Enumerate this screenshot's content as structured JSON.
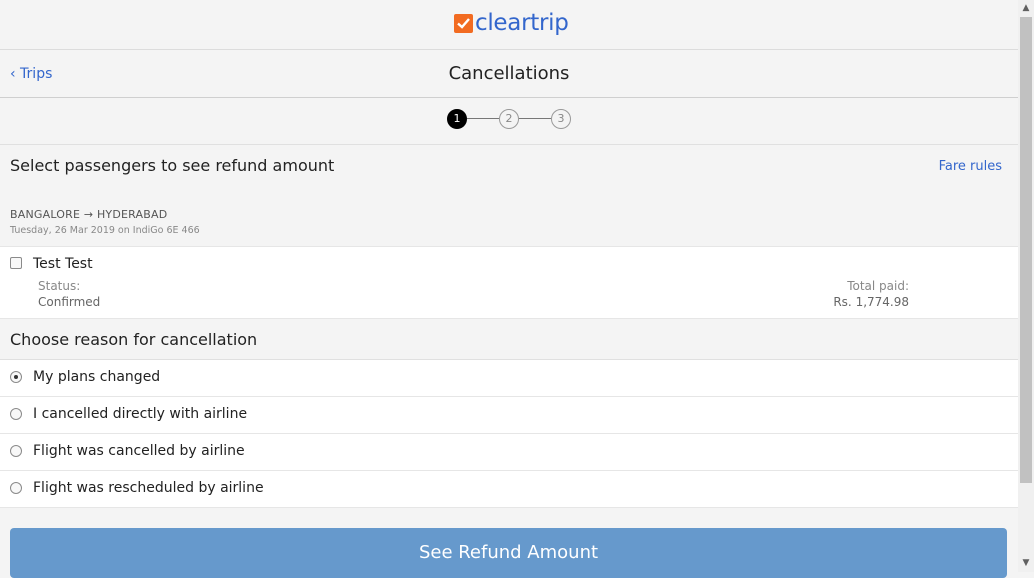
{
  "brand": {
    "logo_text": "cleartrip",
    "logo_color": "#f26b21",
    "text_color": "#3366cc"
  },
  "nav": {
    "back_label": "‹ Trips",
    "title": "Cancellations"
  },
  "stepper": {
    "steps": [
      "1",
      "2",
      "3"
    ],
    "active_step": 1
  },
  "selection": {
    "heading": "Select passengers to see refund amount",
    "fare_rules_label": "Fare rules"
  },
  "flight": {
    "route": "BANGALORE → HYDERABAD",
    "details": "Tuesday, 26 Mar 2019 on IndiGo 6E 466"
  },
  "passenger": {
    "name": "Test Test",
    "checked": false,
    "status_label": "Status:",
    "status_value": "Confirmed",
    "paid_label": "Total paid:",
    "paid_value": "Rs. 1,774.98"
  },
  "cancellation": {
    "heading": "Choose reason for cancellation",
    "reasons": [
      {
        "label": "My plans changed",
        "selected": true
      },
      {
        "label": "I cancelled directly with airline",
        "selected": false
      },
      {
        "label": "Flight was cancelled by airline",
        "selected": false
      },
      {
        "label": "Flight was rescheduled by airline",
        "selected": false
      }
    ]
  },
  "cta": {
    "label": "See Refund Amount",
    "color": "#6699cc"
  }
}
